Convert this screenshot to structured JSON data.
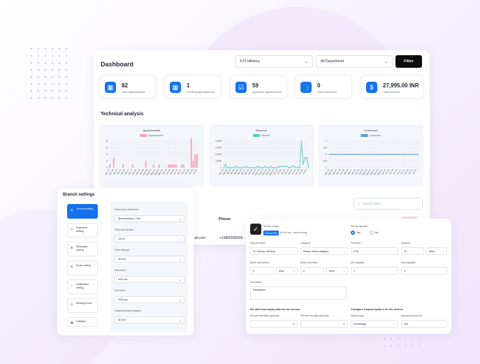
{
  "dashboard": {
    "title": "Dashboard",
    "branch_select": "XYZ bilimora",
    "dept_select": "All Department",
    "filter_label": "Filter",
    "stats": [
      {
        "value": "82",
        "label": "Total appointments",
        "icon": "calendar-icon"
      },
      {
        "value": "1",
        "label": "Pending appointments",
        "icon": "calendar-clock-icon"
      },
      {
        "value": "59",
        "label": "Approved appointments",
        "icon": "calendar-check-icon"
      },
      {
        "value": "0",
        "label": "Total customers",
        "icon": "users-icon"
      },
      {
        "value": "27,995.00 INR",
        "label": "Total revenue",
        "icon": "money-bag-icon"
      }
    ],
    "analysis_title": "Technical analysis",
    "search_placeholder": "Search here...",
    "table_header_phone": "Phone",
    "cell_email": "ail.com",
    "cell_phone": "+19800000000"
  },
  "chart_data": [
    {
      "type": "bar",
      "title": "Appointments",
      "legend": [
        "Appointments"
      ],
      "color": "#f2a3b3",
      "ylim": [
        0,
        8
      ],
      "yticks": [
        "0",
        "2",
        "4",
        "6",
        "8"
      ],
      "categories": [
        "Mar 24",
        "Mar 26",
        "Mar 28",
        "Mar 30",
        "Apr 01",
        "Apr 03",
        "Apr 05",
        "Apr 07",
        "Apr 09",
        "Apr 11",
        "Apr 13",
        "Apr 15",
        "Apr 17",
        "Apr 19",
        "Apr 21",
        "Apr 23",
        "Apr 25",
        "Apr 27",
        "Apr 29",
        "May 01",
        "May 03",
        "May 05",
        "May 07",
        "May 09",
        "May 11",
        "May 13",
        "May 15",
        "May 17",
        "May 19",
        "May 21",
        "Jun 01",
        "Jun 03",
        "Jun 05",
        "Jun 07",
        "Jun 09",
        "Jun 11",
        "Jun 13",
        "Jun 15",
        "Jun 17",
        "Jun 19",
        "Jun 21",
        "Jun 23",
        "Jun 25",
        "Jun 27",
        "Jun 29",
        "Jul 01",
        "Jul 03",
        "Jul 05"
      ],
      "values": [
        1,
        0,
        3,
        0,
        0,
        0,
        0,
        1,
        0,
        0,
        0,
        0,
        1,
        0,
        0,
        0,
        0,
        0,
        0,
        2,
        0,
        0,
        0,
        1,
        0,
        0,
        1,
        0,
        0,
        0,
        0,
        1,
        1,
        1,
        1,
        1,
        0,
        0,
        1,
        1,
        0,
        0,
        0,
        9,
        2,
        4,
        4,
        0
      ]
    },
    {
      "type": "line",
      "title": "Revenue",
      "legend": [
        "Amount"
      ],
      "color": "#5bc8c8",
      "ylim": [
        0,
        4000
      ],
      "yticks": [
        "0",
        "1,000",
        "2,000",
        "3,000",
        "4,000"
      ],
      "values": [
        0,
        500,
        0,
        0,
        0,
        0,
        0,
        200,
        0,
        0,
        0,
        0,
        200,
        0,
        0,
        0,
        0,
        0,
        0,
        200,
        0,
        0,
        0,
        200,
        0,
        0,
        200,
        0,
        0,
        0,
        0,
        200,
        200,
        200,
        200,
        200,
        0,
        0,
        200,
        200,
        0,
        0,
        0,
        4000,
        500,
        1500,
        1500,
        0
      ]
    },
    {
      "type": "line",
      "title": "Customers",
      "legend": [
        "Customers"
      ],
      "color": "#5b9bd5",
      "ylim": [
        -1,
        1
      ],
      "yticks": [
        "-1",
        "-0.5",
        "0",
        "0.5",
        "1"
      ],
      "values": [
        0,
        0,
        0,
        0,
        0,
        0,
        0,
        0,
        0,
        0,
        0,
        0,
        0,
        0,
        0,
        0,
        0,
        0,
        0,
        0,
        0,
        0,
        0,
        0,
        0,
        0,
        0,
        0,
        0,
        0,
        0,
        0,
        0,
        0,
        0,
        0,
        0,
        0,
        0,
        0,
        0,
        0,
        0,
        0,
        0,
        0,
        0,
        0
      ]
    }
  ],
  "branch": {
    "title": "Branch settings",
    "items": [
      "General setting",
      "Payments setting",
      "Messages setting",
      "Email setting",
      "Notification setting",
      "Working hours",
      "Holidays"
    ],
    "fields": [
      {
        "label": "Select your timezone*",
        "value": "America/New_York"
      },
      {
        "label": "Time slot format*",
        "value": "13:00"
      },
      {
        "label": "Time interval*",
        "value": "30 min"
      },
      {
        "label": "Start time*",
        "value": "9:00 am"
      },
      {
        "label": "End time*",
        "value": "9:00 pm"
      },
      {
        "label": "Default service duration",
        "value": "30 min"
      }
    ]
  },
  "service": {
    "image_label": "Service image",
    "choose_file": "Choose File",
    "no_file": "No file cho...seprovin.png",
    "deposit_label": "Service deposit*",
    "yes": "Yes",
    "no": "No",
    "name_label": "Service name*",
    "name_value": "Dr. Fitness, Medical",
    "category_label": "Category*",
    "category_value": "Please select category",
    "price_label": "Price/fee*",
    "price_value": "0.00",
    "duration_label": "Duration*",
    "duration_value": "30",
    "duration_unit": "Mins",
    "buffer_before_label": "Buffer time before*",
    "buffer_before_value": "0",
    "buffer_before_unit": "Mins",
    "buffer_after_label": "Buffer time after*",
    "buffer_after_value": "0",
    "buffer_after_unit": "Mins",
    "min_cap_label": "Min capacity*",
    "min_cap_value": "1",
    "max_cap_label": "Max capacity*",
    "max_cap_value": "0",
    "desc_label": "Description",
    "desc_value": "Description",
    "dates_heading": "Set start and expiry date for the service",
    "start_label": "Service start date (optional)",
    "end_label": "Service end date (optional)",
    "deposit_heading": "Configure Deposit options for the service",
    "deposit_type_label": "Deposit type",
    "deposit_type_value": "Percentage",
    "deposit_amount_label": "Deposit Amount (£)*",
    "deposit_amount_value": "100"
  }
}
